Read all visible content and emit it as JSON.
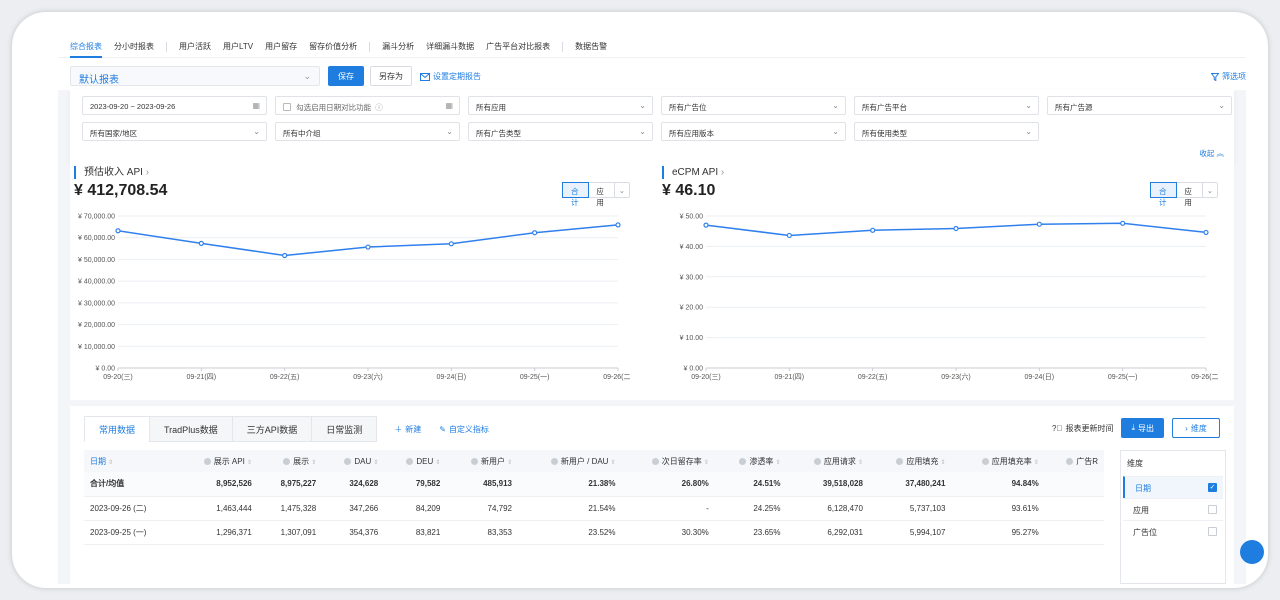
{
  "nav": {
    "items": [
      "综合报表",
      "分小时报表",
      "用户活跃",
      "用户LTV",
      "用户留存",
      "留存价值分析",
      "漏斗分析",
      "详细漏斗数据",
      "广告平台对比报表",
      "数据告警"
    ]
  },
  "toolbar": {
    "report_name": "默认报表",
    "save_label": "保存",
    "save_as_label": "另存为",
    "schedule_label": "设置定期报告",
    "filter_label": "筛选项"
  },
  "filters": {
    "date_range": "2023-09-20 ~ 2023-09-26",
    "compare_label": "勾选启用日期对比功能",
    "app": "所有应用",
    "ad_slot": "所有广告位",
    "ad_platform": "所有广告平台",
    "ad_source": "所有广告源",
    "country": "所有国家/地区",
    "intermediary": "所有中介组",
    "ad_type": "所有广告类型",
    "app_version": "所有应用版本",
    "usage_type": "所有使用类型",
    "collapse_label": "收起"
  },
  "charts": {
    "left": {
      "title": "预估收入 API",
      "value": "¥ 412,708.54",
      "seg_total": "合计",
      "seg_app": "应用"
    },
    "right": {
      "title": "eCPM API",
      "value": "¥ 46.10",
      "seg_total": "合计",
      "seg_app": "应用"
    }
  },
  "chart_data": [
    {
      "type": "line",
      "title": "预估收入 API",
      "categories": [
        "09-20(三)",
        "09-21(四)",
        "09-22(五)",
        "09-23(六)",
        "09-24(日)",
        "09-25(一)",
        "09-26(二)"
      ],
      "values": [
        63200,
        57400,
        51800,
        55700,
        57200,
        62300,
        65900
      ],
      "ylim": [
        0,
        70000
      ],
      "yticks": [
        "¥ 0.00",
        "¥ 10,000.00",
        "¥ 20,000.00",
        "¥ 30,000.00",
        "¥ 40,000.00",
        "¥ 50,000.00",
        "¥ 60,000.00",
        "¥ 70,000.00"
      ],
      "color": "#2f80ed",
      "grid": true
    },
    {
      "type": "line",
      "title": "eCPM API",
      "categories": [
        "09-20(三)",
        "09-21(四)",
        "09-22(五)",
        "09-23(六)",
        "09-24(日)",
        "09-25(一)",
        "09-26(二)"
      ],
      "values": [
        47.0,
        43.6,
        45.3,
        45.9,
        47.3,
        47.6,
        44.6
      ],
      "ylim": [
        0,
        50
      ],
      "yticks": [
        "¥ 0.00",
        "¥ 10.00",
        "¥ 20.00",
        "¥ 30.00",
        "¥ 40.00",
        "¥ 50.00"
      ],
      "color": "#2f80ed",
      "grid": true
    }
  ],
  "table": {
    "tabs": [
      "常用数据",
      "TradPlus数据",
      "三方API数据",
      "日常监测"
    ],
    "new_label": "新建",
    "custom_label": "自定义指标",
    "update_time_label": "报表更新时间",
    "export_label": "导出",
    "dimension_label": "维度",
    "columns": [
      "日期",
      "展示 API",
      "展示",
      "DAU",
      "DEU",
      "新用户",
      "新用户 / DAU",
      "次日留存率",
      "渗透率",
      "应用请求",
      "应用填充",
      "应用填充率",
      "广告R"
    ],
    "rows": [
      [
        "合计/均值",
        "8,952,526",
        "8,975,227",
        "324,628",
        "79,582",
        "485,913",
        "21.38%",
        "26.80%",
        "24.51%",
        "39,518,028",
        "37,480,241",
        "94.84%",
        ""
      ],
      [
        "2023-09-26 (二)",
        "1,463,444",
        "1,475,328",
        "347,266",
        "84,209",
        "74,792",
        "21.54%",
        "-",
        "24.25%",
        "6,128,470",
        "5,737,103",
        "93.61%",
        ""
      ],
      [
        "2023-09-25 (一)",
        "1,296,371",
        "1,307,091",
        "354,376",
        "83,821",
        "83,353",
        "23.52%",
        "30.30%",
        "23.65%",
        "6,292,031",
        "5,994,107",
        "95.27%",
        ""
      ]
    ]
  },
  "dimension_panel": {
    "title": "维度",
    "items": [
      "日期",
      "应用",
      "广告位"
    ]
  }
}
